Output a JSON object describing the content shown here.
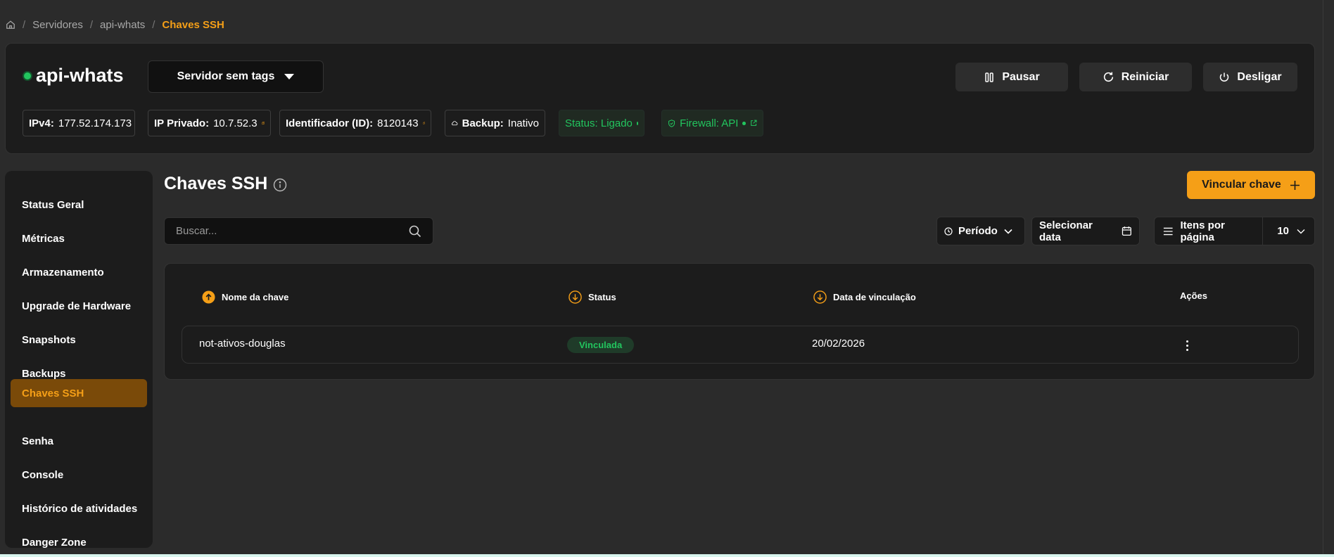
{
  "breadcrumb": {
    "home_icon": "home-icon",
    "items": [
      "Servidores",
      "api-whats"
    ],
    "current": "Chaves SSH"
  },
  "server": {
    "name": "api-whats",
    "tags_label": "Servidor sem tags",
    "actions": {
      "pause": "Pausar",
      "restart": "Reiniciar",
      "shutdown": "Desligar"
    },
    "info": {
      "ipv4_label": "IPv4:",
      "ipv4_value": "177.52.174.173",
      "private_ip_label": "IP Privado:",
      "private_ip_value": "10.7.52.3",
      "id_label": "Identificador (ID):",
      "id_value": "8120143",
      "backup_label": "Backup:",
      "backup_value": "Inativo",
      "status_text": "Status: Ligado",
      "firewall_text": "Firewall: API"
    }
  },
  "sidebar": {
    "items": [
      {
        "label": "Status Geral"
      },
      {
        "label": "Métricas"
      },
      {
        "label": "Armazenamento"
      },
      {
        "label": "Upgrade de Hardware"
      },
      {
        "label": "Snapshots"
      },
      {
        "label": "Backups"
      },
      {
        "label": "Chaves SSH",
        "active": true
      },
      {
        "label": "Senha"
      },
      {
        "label": "Console"
      },
      {
        "label": "Histórico de atividades"
      },
      {
        "label": "Danger Zone"
      }
    ]
  },
  "main": {
    "title": "Chaves SSH",
    "link_button": "Vincular chave",
    "search_placeholder": "Buscar...",
    "period_label": "Período",
    "date_label": "Selecionar data",
    "per_page_label": "Itens por página",
    "per_page_value": "10",
    "table": {
      "headers": [
        "Nome da chave",
        "Status",
        "Data de vinculação",
        "Ações"
      ],
      "rows": [
        {
          "name": "not-ativos-douglas",
          "status": "Vinculada",
          "date": "20/02/2026"
        }
      ]
    }
  },
  "colors": {
    "accent": "#f59f17",
    "success": "#22c55e",
    "background": "#2b2b2b",
    "card": "#1c1c1c"
  }
}
